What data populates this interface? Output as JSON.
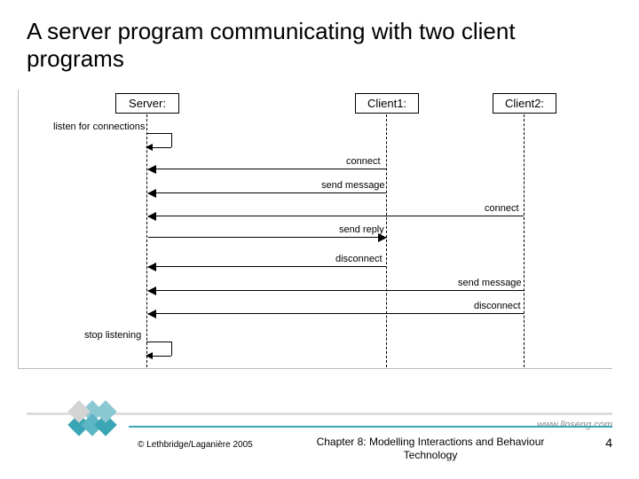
{
  "title": "A server program communicating with two client programs",
  "lifelines": {
    "server": "Server:",
    "client1": "Client1:",
    "client2": "Client2:"
  },
  "messages": {
    "listen": "listen for connections",
    "connect1": "connect",
    "send_msg1": "send message",
    "send_reply1": "send reply",
    "connect2": "connect",
    "disconnect1": "disconnect",
    "send_msg2": "send message",
    "disconnect2": "disconnect",
    "stop_listen": "stop listening"
  },
  "website": "www.lloseng.com",
  "copyright": "© Lethbridge/Laganière 2005",
  "chapter_line": "Chapter 8: Modelling Interactions and Behaviour",
  "technology_line": "Technology",
  "page_number": "4",
  "decoration": {
    "teal_color": "#3aa5b5",
    "light_teal": "#8cc8d2",
    "grey": "#ccc"
  }
}
